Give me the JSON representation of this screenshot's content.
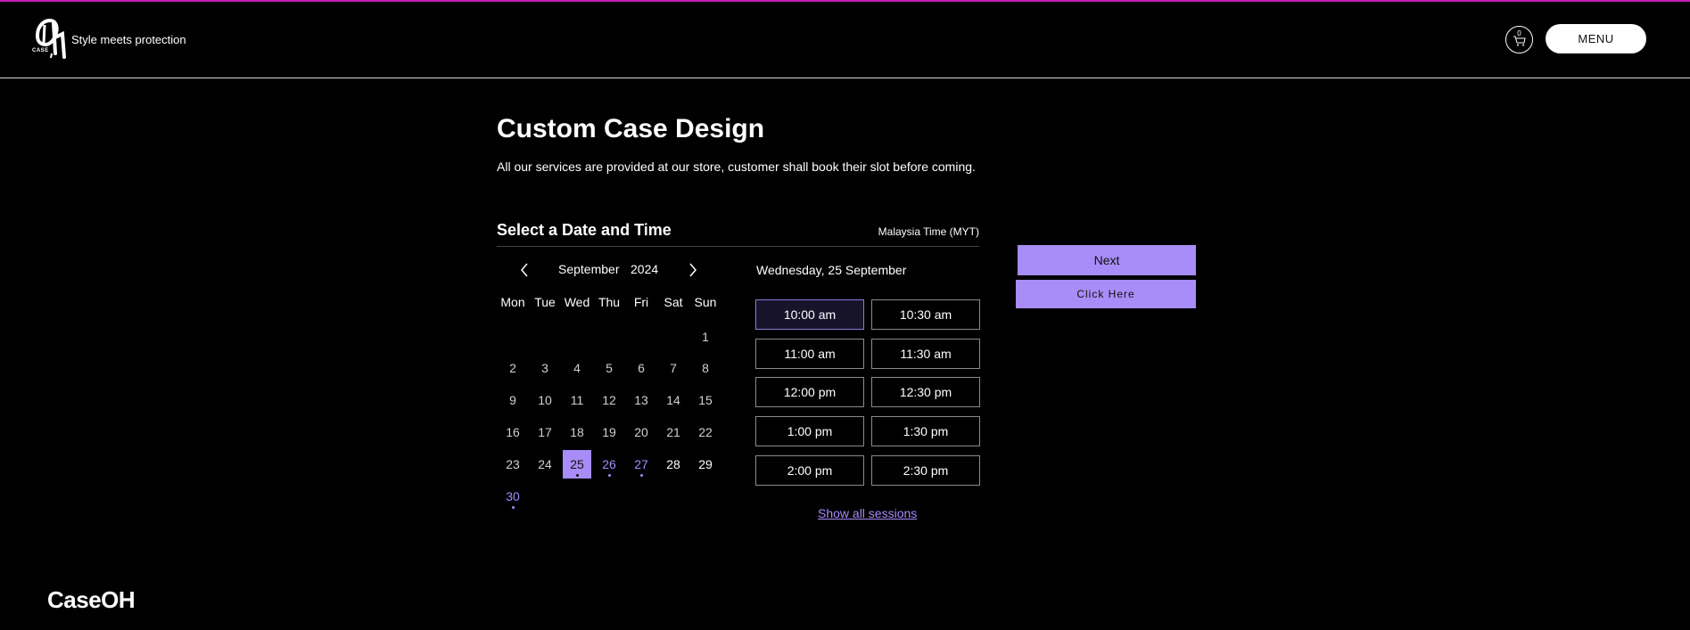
{
  "header": {
    "tagline": "Style meets protection",
    "logo_text": "CASE",
    "cart_count": "0",
    "menu_label": "MENU"
  },
  "page": {
    "title": "Custom Case Design",
    "subtitle": "All our services are provided at our store, customer shall book their slot before coming."
  },
  "booking": {
    "section_title": "Select a Date and Time",
    "timezone": "Malaysia Time (MYT)",
    "month": "September",
    "year": "2024",
    "weekdays": [
      "Mon",
      "Tue",
      "Wed",
      "Thu",
      "Fri",
      "Sat",
      "Sun"
    ],
    "days": [
      "1",
      "2",
      "3",
      "4",
      "5",
      "6",
      "7",
      "8",
      "9",
      "10",
      "11",
      "12",
      "13",
      "14",
      "15",
      "16",
      "17",
      "18",
      "19",
      "20",
      "21",
      "22",
      "23",
      "24",
      "25",
      "26",
      "27",
      "28",
      "29",
      "30"
    ],
    "selected_day": "25",
    "available_days": [
      "25",
      "26",
      "27",
      "30"
    ],
    "selected_date_label": "Wednesday, 25 September",
    "slots": [
      "10:00 am",
      "10:30 am",
      "11:00 am",
      "11:30 am",
      "12:00 pm",
      "12:30 pm",
      "1:00 pm",
      "1:30 pm",
      "2:00 pm",
      "2:30 pm"
    ],
    "selected_slot": "10:00 am",
    "show_all_label": "Show all sessions",
    "next_label": "Next",
    "click_here_label": "Click Here"
  },
  "footer": {
    "brand": "CaseOH"
  },
  "colors": {
    "accent": "#a88cf7",
    "top_bar": "#c21fb4",
    "background": "#000000"
  },
  "icons": [
    "cart-icon",
    "chevron-left-icon",
    "chevron-right-icon",
    "logo-icon"
  ]
}
